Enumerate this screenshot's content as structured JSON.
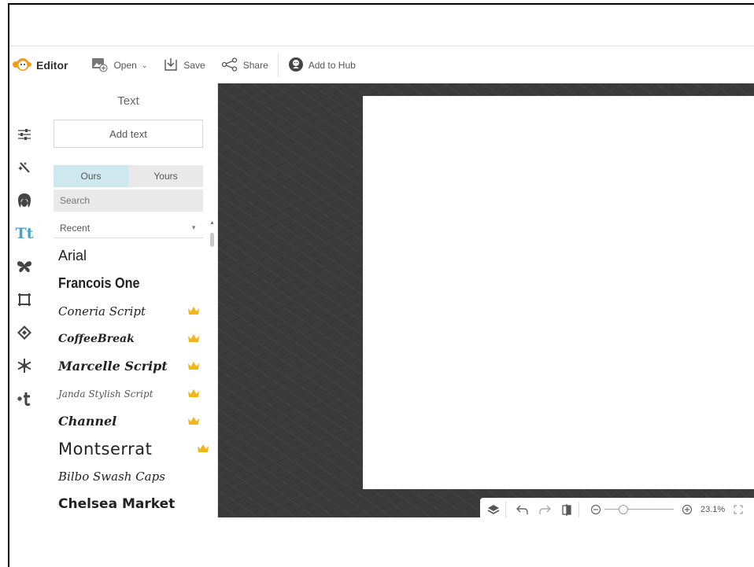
{
  "toolbar": {
    "brand": "Editor",
    "open": "Open",
    "save": "Save",
    "share": "Share",
    "add_to_hub": "Add to Hub"
  },
  "sidebar": {
    "icons": [
      "adjust-icon",
      "effects-wand-icon",
      "touch-up-face-icon",
      "text-icon",
      "overlays-butterfly-icon",
      "frames-icon",
      "textures-icon",
      "designs-snowflake-icon",
      "themes-icon"
    ],
    "active_icon_label": "Tt"
  },
  "panel": {
    "title": "Text",
    "add_text": "Add text",
    "tabs": [
      "Ours",
      "Yours"
    ],
    "search_placeholder": "Search",
    "filter": "Recent",
    "fonts": [
      {
        "name": "Arial",
        "premium": false
      },
      {
        "name": "Francois One",
        "premium": false
      },
      {
        "name": "Coneria Script",
        "premium": true
      },
      {
        "name": "CoffeeBreak",
        "premium": true
      },
      {
        "name": "Marcelle Script",
        "premium": true
      },
      {
        "name": "Janda Stylish Script",
        "premium": true
      },
      {
        "name": "Channel",
        "premium": true
      },
      {
        "name": "Montserrat",
        "premium": true
      },
      {
        "name": "Bilbo Swash Caps",
        "premium": false
      },
      {
        "name": "Chelsea Market",
        "premium": false
      }
    ]
  },
  "bottombar": {
    "zoom": "23.1%"
  },
  "colors": {
    "accent": "#4aa3c8",
    "tab_active": "#cfe7ef",
    "crown": "#f2b619",
    "brand_orange": "#f39a1e",
    "canvas": "#3b3b3b"
  }
}
